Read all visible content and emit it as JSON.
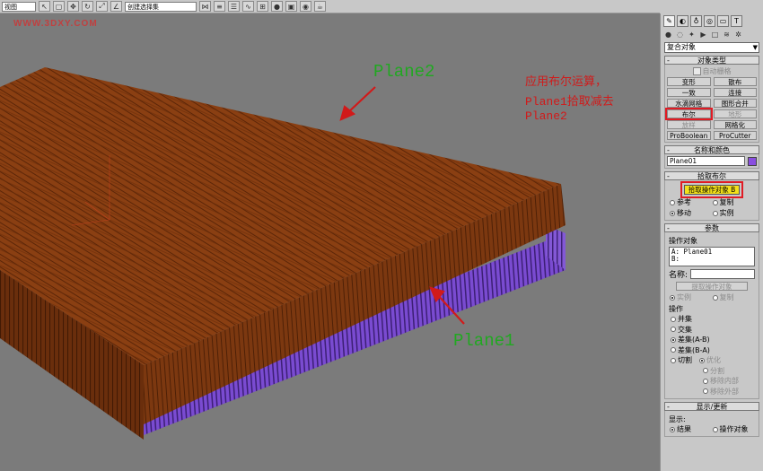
{
  "toolbar": {
    "view_combo": "视图",
    "selection_set": "创建选择集",
    "icons": [
      "arrow-icon",
      "select-icon",
      "move-icon",
      "rotate-icon",
      "scale-icon",
      "snap-icon",
      "mirror-icon",
      "align-icon",
      "layer-icon",
      "curve-icon",
      "schematic-icon",
      "material-icon",
      "render-setup-icon",
      "render-icon",
      "teapot-icon"
    ]
  },
  "viewport": {
    "background": "#7b7b7b",
    "watermark": "WWW.3DXY.COM",
    "label_plane2": "Plane2",
    "label_plane1": "Plane1",
    "annotation": [
      "应用布尔运算，",
      "Plane1拾取减去",
      "Plane2"
    ],
    "colors": {
      "plane2": "#8a3f12",
      "plane1": "#7a4bd1",
      "annotation": "#d11a1a",
      "label": "#21a821"
    }
  },
  "panel": {
    "category_dropdown": "复合对象",
    "object_type": {
      "title": "对象类型",
      "autogrid": "自动栅格",
      "buttons": [
        {
          "label": "变形",
          "enabled": true
        },
        {
          "label": "散布",
          "enabled": true
        },
        {
          "label": "一致",
          "enabled": true
        },
        {
          "label": "连接",
          "enabled": true
        },
        {
          "label": "水滴网格",
          "enabled": true
        },
        {
          "label": "图形合并",
          "enabled": true
        },
        {
          "label": "布尔",
          "enabled": true,
          "highlight": true
        },
        {
          "label": "地形",
          "enabled": false
        },
        {
          "label": "放样",
          "enabled": false
        },
        {
          "label": "网格化",
          "enabled": true
        },
        {
          "label": "ProBoolean",
          "enabled": true
        },
        {
          "label": "ProCutter",
          "enabled": true
        }
      ]
    },
    "name_color": {
      "title": "名称和颜色",
      "name": "Plane01",
      "color": "#8a4fe0"
    },
    "pick_boolean": {
      "title": "拾取布尔",
      "pick_button": "拾取操作对象 B",
      "options": [
        {
          "label": "参考",
          "selected": false
        },
        {
          "label": "复制",
          "selected": false
        },
        {
          "label": "移动",
          "selected": true
        },
        {
          "label": "实例",
          "selected": false
        }
      ]
    },
    "parameters": {
      "title": "参数",
      "operands_label": "操作对象",
      "operand_a": "A: Plane01",
      "operand_b": "B:",
      "name_label": "名称:",
      "extract_button": "提取操作对象",
      "extract_options": [
        {
          "label": "实例",
          "selected": true
        },
        {
          "label": "复制",
          "selected": false
        }
      ],
      "operation_label": "操作",
      "operations": [
        {
          "label": "并集",
          "selected": false
        },
        {
          "label": "交集",
          "selected": false
        },
        {
          "label": "差集(A-B)",
          "selected": true
        },
        {
          "label": "差集(B-A)",
          "selected": false
        },
        {
          "label": "切割",
          "selected": false
        }
      ],
      "cut_options": [
        {
          "label": "优化",
          "selected": true
        },
        {
          "label": "分割",
          "selected": false
        },
        {
          "label": "移除内部",
          "selected": false
        },
        {
          "label": "移除外部",
          "selected": false
        }
      ]
    },
    "display_update": {
      "title": "显示/更新",
      "display_label": "显示:",
      "options": [
        {
          "label": "结果",
          "selected": true
        },
        {
          "label": "操作对象",
          "selected": false
        }
      ]
    },
    "tab_icons": [
      "create-icon",
      "modify-icon",
      "hierarchy-icon",
      "motion-icon",
      "display-icon",
      "utilities-icon"
    ]
  }
}
